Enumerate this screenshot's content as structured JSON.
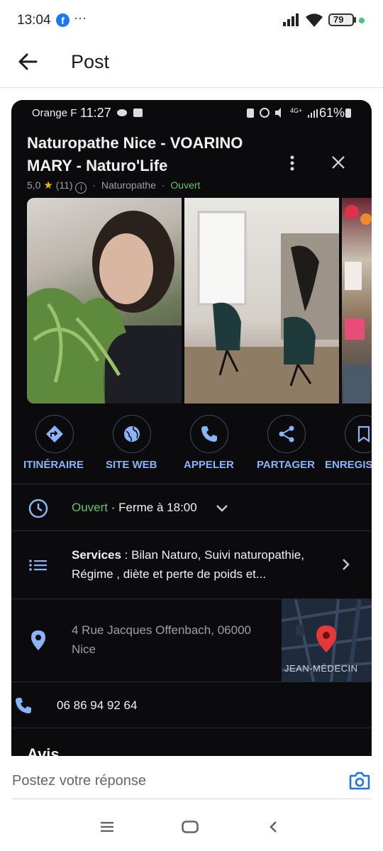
{
  "statusbar": {
    "time": "13:04",
    "more": "···",
    "battery": "79"
  },
  "appbar": {
    "title": "Post"
  },
  "shot": {
    "status": {
      "carrier": "Orange F",
      "time": "11:27",
      "net": "4G+",
      "battery": "61%"
    },
    "place": {
      "name_line1": "Naturopathe Nice - VOARINO",
      "name_line2": "MARY - Naturo'Life",
      "rating": "5,0",
      "reviews": "(11)",
      "category": "Naturopathe",
      "open": "Ouvert",
      "sep": "·"
    },
    "actions": [
      "ITINÉRAIRE",
      "SITE WEB",
      "APPELER",
      "PARTAGER",
      "ENREGIS"
    ],
    "hours": {
      "open": "Ouvert",
      "closes": " · Ferme à 18:00"
    },
    "services": {
      "label": "Services",
      "text1": " : Bilan Naturo, Suivi naturopathie,",
      "text2": "Régime , diète et perte de poids et..."
    },
    "address": {
      "line1": "4 Rue Jacques Offenbach, 06000",
      "line2": "Nice",
      "map_label": "JEAN-MÉDECIN"
    },
    "phone": "06 86 94 92 64",
    "reviews_heading": "Avis"
  },
  "reply": {
    "placeholder": "Postez votre réponse"
  },
  "colors": {
    "open_green": "#5fc768",
    "link_blue": "#8ab4f8",
    "dark_bg": "#0b0b0d",
    "accent": "#1a73e8",
    "pin_red": "#e5383b"
  }
}
